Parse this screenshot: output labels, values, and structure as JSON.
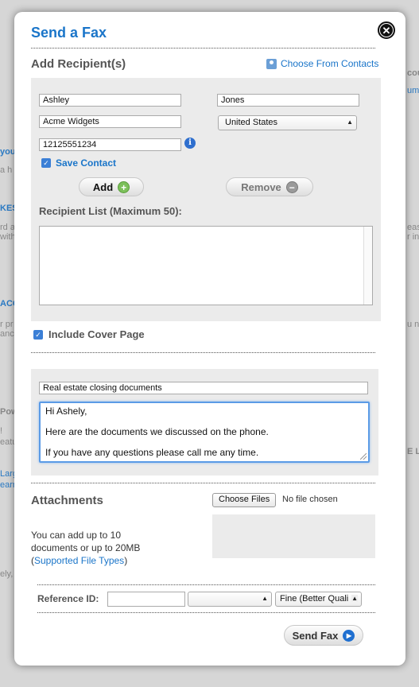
{
  "background": {
    "fragments": [
      "you",
      "a h",
      "KES",
      "rd a",
      "with",
      "ACC",
      "r pr",
      "anc",
      "Pow",
      "!",
      "eatu",
      "Larg",
      "earn",
      "ely,",
      "cou",
      "um",
      "eas",
      "r in",
      "u ne",
      "E La"
    ]
  },
  "dialog": {
    "title": "Send a Fax",
    "close_label": "✕"
  },
  "recipients": {
    "heading": "Add Recipient(s)",
    "choose_contacts_label": "Choose From Contacts",
    "first_name": "Ashley",
    "last_name": "Jones",
    "company": "Acme Widgets",
    "country": "United States",
    "fax_number": "12125551234",
    "info_label": "i",
    "save_contact_label": "Save Contact",
    "add_label": "Add",
    "remove_label": "Remove",
    "list_heading": "Recipient List (Maximum 50):"
  },
  "cover": {
    "include_label": "Include Cover Page",
    "subject": "Real estate closing documents",
    "message_lines": [
      "Hi Ashely,",
      "Here are the documents we discussed on the phone.",
      "If you have any questions please call me any time."
    ]
  },
  "attachments": {
    "heading": "Attachments",
    "choose_files_label": "Choose Files",
    "no_file_label": "No file chosen",
    "help_line1": "You can add up to 10",
    "help_line2": "documents or up to 20MB",
    "help_paren_open": "(",
    "help_link": "Supported File Types",
    "help_paren_close": ")"
  },
  "options": {
    "reference_label": "Reference ID:",
    "reference_value": "",
    "middle_select_value": "",
    "quality_value": "Fine (Better Quali"
  },
  "footer": {
    "send_label": "Send Fax"
  },
  "colors": {
    "accent": "#1a75c9",
    "panel": "#ebebeb"
  }
}
